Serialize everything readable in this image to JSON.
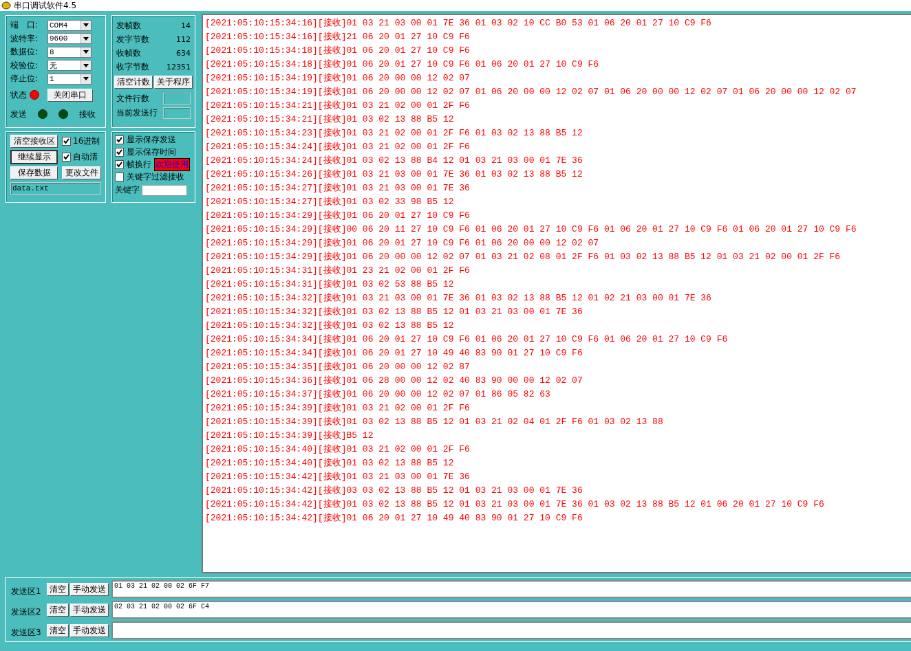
{
  "window": {
    "title": "串口调试软件4.5"
  },
  "port_settings": [
    {
      "label": "端　口:",
      "value": "COM4"
    },
    {
      "label": "波特率:",
      "value": "9600"
    },
    {
      "label": "数据位:",
      "value": "8"
    },
    {
      "label": "校验位:",
      "value": "无"
    },
    {
      "label": "停止位:",
      "value": "1"
    }
  ],
  "status": {
    "label": "状态",
    "on": true
  },
  "close_port_button": "关闭串口",
  "indicators": [
    {
      "label": "发送",
      "on": false
    },
    {
      "label": "接收",
      "on": false
    }
  ],
  "counters": [
    {
      "label": "发帧数",
      "value": "14"
    },
    {
      "label": "发字节数",
      "value": "112"
    },
    {
      "label": "收帧数",
      "value": "634"
    },
    {
      "label": "收字节数",
      "value": "12351"
    }
  ],
  "counter_buttons": [
    "清空计数",
    "关于程序"
  ],
  "file_fields": [
    {
      "label": "文件行数"
    },
    {
      "label": "当前发送行"
    }
  ],
  "receive_buttons": [
    "清空接收区",
    "继续显示",
    "保存数据",
    "更改文件"
  ],
  "receive_checkboxes": [
    {
      "label": "16进制",
      "checked": true
    },
    {
      "label": "自动清",
      "checked": true
    }
  ],
  "file_name": "data.txt",
  "display_options": [
    {
      "label": "显示保存发送",
      "checked": true
    },
    {
      "label": "显示保存时间",
      "checked": true
    },
    {
      "label": "帧换行",
      "checked": true
    },
    {
      "label": "关键字过滤接收",
      "checked": false
    }
  ],
  "welcome_badge": "欢迎使用",
  "keyword": {
    "label": "关键字"
  },
  "log": [
    "[2021:05:10:15:34:16][接收]01 03 21 03 00 01 7E 36 01 03 02 10 CC B0 53 01 06 20 01 27 10 C9 F6",
    "[2021:05:10:15:34:16][接收]21 06 20 01 27 10 C9 F6",
    "[2021:05:10:15:34:18][接收]01 06 20 01 27 10 C9 F6",
    "[2021:05:10:15:34:18][接收]01 06 20 01 27 10 C9 F6 01 06 20 01 27 10 C9 F6",
    "[2021:05:10:15:34:19][接收]01 06 20 00 00 12 02 07",
    "[2021:05:10:15:34:19][接收]01 06 20 00 00 12 02 07 01 06 20 00 00 12 02 07 01 06 20 00 00 12 02 07 01 06 20 00 00 12 02 07",
    "[2021:05:10:15:34:21][接收]01 03 21 02 00 01 2F F6",
    "[2021:05:10:15:34:21][接收]01 03 02 13 88 B5 12",
    "[2021:05:10:15:34:23][接收]01 03 21 02 00 01 2F F6 01 03 02 13 88 B5 12",
    "[2021:05:10:15:34:24][接收]01 03 21 02 00 01 2F F6",
    "[2021:05:10:15:34:24][接收]01 03 02 13 88 B4 12 01 03 21 03 00 01 7E 36",
    "[2021:05:10:15:34:26][接收]01 03 21 03 00 01 7E 36 01 03 02 13 88 B5 12",
    "[2021:05:10:15:34:27][接收]01 03 21 03 00 01 7E 36",
    "[2021:05:10:15:34:27][接收]01 03 02 33 98 B5 12",
    "[2021:05:10:15:34:29][接收]01 06 20 01 27 10 C9 F6",
    "[2021:05:10:15:34:29][接收]00 06 20 11 27 10 C9 F6 01 06 20 01 27 10 C9 F6 01 06 20 01 27 10 C9 F6 01 06 20 01 27 10 C9 F6",
    "[2021:05:10:15:34:29][接收]01 06 20 01 27 10 C9 F6 01 06 20 00 00 12 02 07",
    "[2021:05:10:15:34:29][接收]01 06 20 00 00 12 02 07 01 03 21 02 08 01 2F F6 01 03 02 13 88 B5 12 01 03 21 02 00 01 2F F6",
    "[2021:05:10:15:34:31][接收]01 23 21 02 00 01 2F F6",
    "[2021:05:10:15:34:31][接收]01 03 02 53 88 B5 12",
    "[2021:05:10:15:34:32][接收]01 03 21 03 00 01 7E 36 01 03 02 13 88 B5 12 01 02 21 03 00 01 7E 36",
    "[2021:05:10:15:34:32][接收]01 03 02 13 88 B5 12 01 03 21 03 00 01 7E 36",
    "[2021:05:10:15:34:32][接收]01 03 02 13 88 B5 12",
    "[2021:05:10:15:34:34][接收]01 06 20 01 27 10 C9 F6 01 06 20 01 27 10 C9 F6 01 06 20 01 27 10 C9 F6",
    "[2021:05:10:15:34:34][接收]01 06 20 01 27 10 49 40 83 90 01 27 10 C9 F6",
    "[2021:05:10:15:34:35][接收]01 06 20 00 00 12 02 87",
    "[2021:05:10:15:34:36][接收]01 06 28 00 00 12 02 40 83 90 00 00 12 02 07",
    "[2021:05:10:15:34:37][接收]01 06 20 00 00 12 02 07 01 86 05 82 63",
    "[2021:05:10:15:34:39][接收]01 03 21 02 00 01 2F F6",
    "[2021:05:10:15:34:39][接收]01 03 02 13 88 B5 12 01 03 21 02 04 01 2F F6 01 03 02 13 88",
    "[2021:05:10:15:34:39][接收]B5 12",
    "[2021:05:10:15:34:40][接收]01 03 21 02 00 01 2F F6",
    "[2021:05:10:15:34:40][接收]01 03 02 13 88 B5 12",
    "[2021:05:10:15:34:42][接收]01 03 21 03 00 01 7E 36",
    "[2021:05:10:15:34:42][接收]03 03 02 13 88 B5 12 01 03 21 03 00 01 7E 36",
    "[2021:05:10:15:34:42][接收]01 03 02 13 88 B5 12 01 03 21 03 00 01 7E 36 01 03 02 13 88 B5 12 01 06 20 01 27 10 C9 F6",
    "[2021:05:10:15:34:42][接收]01 06 20 01 27 10 49 40 83 90 01 27 10 C9 F6"
  ],
  "send_areas": [
    {
      "label": "发送区1",
      "clear_button": "清空",
      "send_button": "手动发送",
      "value": "01 03 21 02 00 02 6F F7"
    },
    {
      "label": "发送区2",
      "clear_button": "清空",
      "send_button": "手动发送",
      "value": "02 03 21 02 00 02 6F C4"
    },
    {
      "label": "发送区3",
      "clear_button": "清空",
      "send_button": "手动发送"
    }
  ]
}
